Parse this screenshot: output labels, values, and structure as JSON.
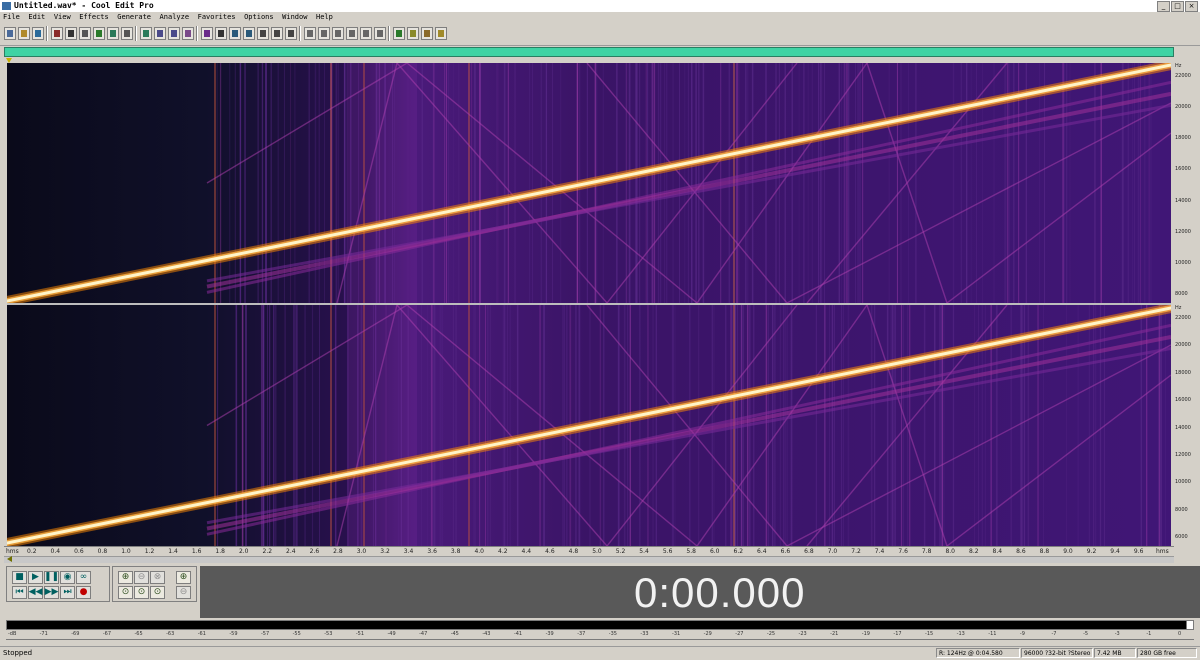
{
  "window": {
    "title": "Untitled.wav* - Cool Edit Pro"
  },
  "menu": [
    "File",
    "Edit",
    "View",
    "Effects",
    "Generate",
    "Analyze",
    "Favorites",
    "Options",
    "Window",
    "Help"
  ],
  "colors": {
    "overview": "#3fd3a4",
    "spectrum_bg": "#0b0b1e",
    "chirp_core": "#fff4c8",
    "time_display_bg": "#595959"
  },
  "frequency_scale": {
    "top_unit": "Hz",
    "top": [
      "22000",
      "20000",
      "18000",
      "16000",
      "14000",
      "12000",
      "10000",
      "8000"
    ],
    "bottom_unit": "Hz",
    "bottom": [
      "22000",
      "20000",
      "18000",
      "16000",
      "14000",
      "12000",
      "10000",
      "8000",
      "6000"
    ]
  },
  "timeline": {
    "unit": "hms",
    "labels": [
      "0.2",
      "0.4",
      "0.6",
      "0.8",
      "1.0",
      "1.2",
      "1.4",
      "1.6",
      "1.8",
      "2.0",
      "2.2",
      "2.4",
      "2.6",
      "2.8",
      "3.0",
      "3.2",
      "3.4",
      "3.6",
      "3.8",
      "4.0",
      "4.2",
      "4.4",
      "4.6",
      "4.8",
      "5.0",
      "5.2",
      "5.4",
      "5.6",
      "5.8",
      "6.0",
      "6.2",
      "6.4",
      "6.6",
      "6.8",
      "7.0",
      "7.2",
      "7.4",
      "7.6",
      "7.8",
      "8.0",
      "8.2",
      "8.4",
      "8.6",
      "8.8",
      "9.0",
      "9.2",
      "9.4",
      "9.6"
    ],
    "end_unit": "hms"
  },
  "transport": {
    "time": "0:00.000"
  },
  "meter": {
    "scale": [
      "-dB",
      "-71",
      "-69",
      "-67",
      "-65",
      "-63",
      "-61",
      "-59",
      "-57",
      "-55",
      "-53",
      "-51",
      "-49",
      "-47",
      "-45",
      "-43",
      "-41",
      "-39",
      "-37",
      "-35",
      "-33",
      "-31",
      "-29",
      "-27",
      "-25",
      "-23",
      "-21",
      "-19",
      "-17",
      "-15",
      "-13",
      "-11",
      "-9",
      "-7",
      "-5",
      "-3",
      "-1",
      "0"
    ]
  },
  "status": {
    "state": "Stopped",
    "cursor": "R: 124Hz @  0:04.580",
    "format": "96000 ?32-bit ?Stereo",
    "size": "7.42 MB",
    "free": "280 GB free"
  }
}
